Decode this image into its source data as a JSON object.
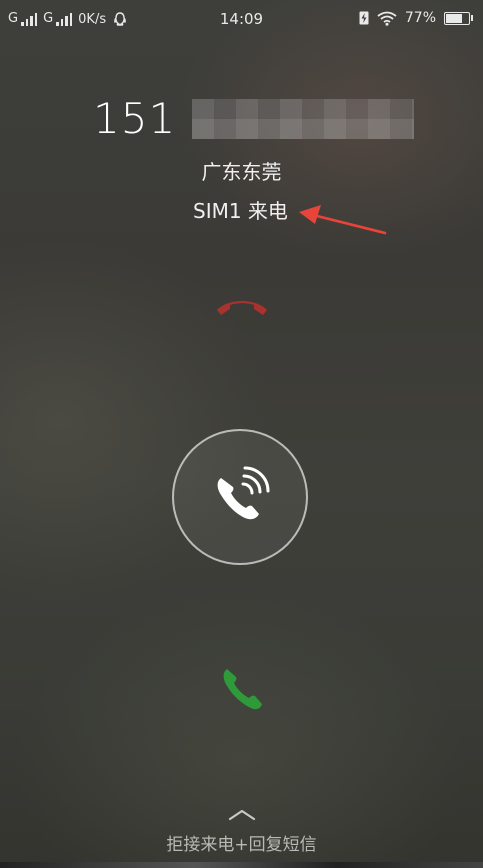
{
  "status_bar": {
    "sim1_network": "G",
    "sim2_network": "G",
    "data_speed": "0K/s",
    "time": "14:09",
    "battery_percent": "77%",
    "battery_level": 0.77,
    "icons": [
      "signal-bars-icon",
      "signal-bars-icon",
      "qq-icon",
      "charging-icon",
      "wifi-icon",
      "battery-icon"
    ]
  },
  "caller": {
    "number_prefix": "151",
    "location": "广东东莞",
    "sim_label": "SIM1 来电"
  },
  "controls": {
    "reject_icon": "phone-hangup-icon",
    "answer_icon": "phone-ringing-icon",
    "accept_icon": "phone-accept-icon",
    "swipe_up_icon": "chevron-up-icon",
    "swipe_hint": "拒接来电+回复短信"
  },
  "colors": {
    "reject": "#a8322e",
    "accept": "#2e9a3a",
    "annotation_arrow": "#e8443a"
  }
}
